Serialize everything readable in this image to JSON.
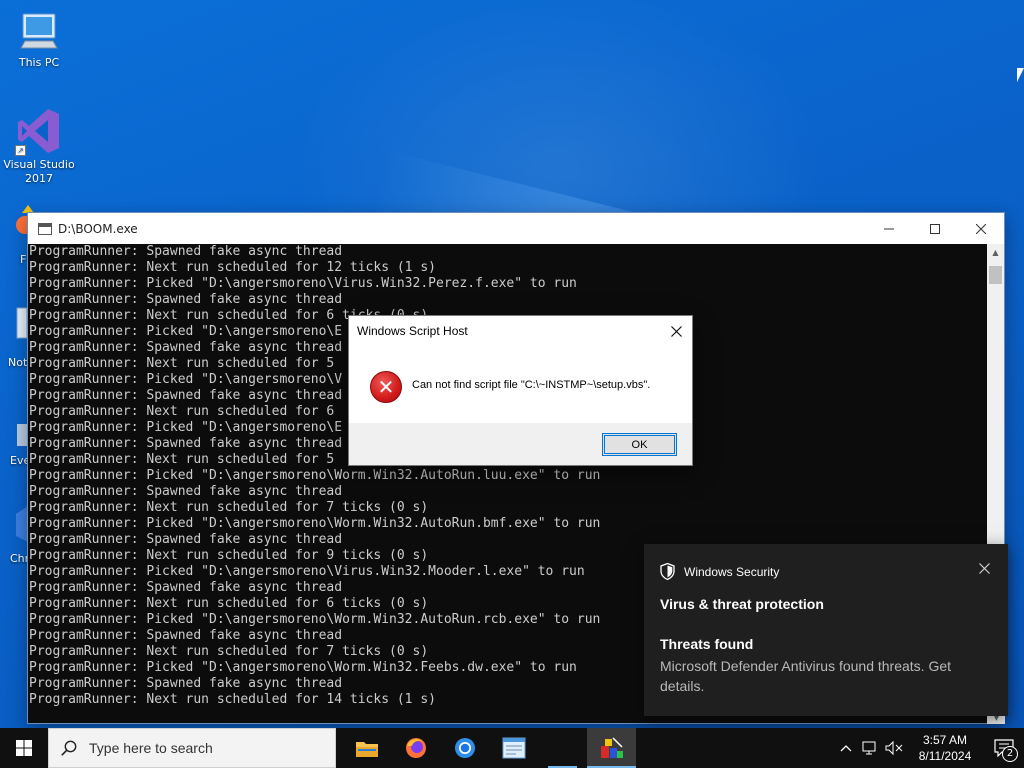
{
  "desktop": {
    "icons": [
      {
        "label": "This PC"
      },
      {
        "label": "Visual Studio 2017"
      }
    ],
    "partial_labels": [
      "F",
      "Not",
      "Eve",
      "Chr"
    ]
  },
  "console": {
    "title": "D:\\BOOM.exe",
    "lines": [
      "ProgramRunner: Spawned fake async thread",
      "ProgramRunner: Next run scheduled for 12 ticks (1 s)",
      "ProgramRunner: Picked \"D:\\angersmoreno\\Virus.Win32.Perez.f.exe\" to run",
      "ProgramRunner: Spawned fake async thread",
      "ProgramRunner: Next run scheduled for 6 ticks (0 s)",
      "ProgramRunner: Picked \"D:\\angersmoreno\\E",
      "ProgramRunner: Spawned fake async thread",
      "ProgramRunner: Next run scheduled for 5",
      "ProgramRunner: Picked \"D:\\angersmoreno\\V",
      "ProgramRunner: Spawned fake async thread",
      "ProgramRunner: Next run scheduled for 6",
      "ProgramRunner: Picked \"D:\\angersmoreno\\E",
      "ProgramRunner: Spawned fake async thread",
      "ProgramRunner: Next run scheduled for 5",
      "ProgramRunner: Picked \"D:\\angersmoreno\\Worm.Win32.AutoRun.luu.exe\" to run",
      "ProgramRunner: Spawned fake async thread",
      "ProgramRunner: Next run scheduled for 7 ticks (0 s)",
      "ProgramRunner: Picked \"D:\\angersmoreno\\Worm.Win32.AutoRun.bmf.exe\" to run",
      "ProgramRunner: Spawned fake async thread",
      "ProgramRunner: Next run scheduled for 9 ticks (0 s)",
      "ProgramRunner: Picked \"D:\\angersmoreno\\Virus.Win32.Mooder.l.exe\" to run",
      "ProgramRunner: Spawned fake async thread",
      "ProgramRunner: Next run scheduled for 6 ticks (0 s)",
      "ProgramRunner: Picked \"D:\\angersmoreno\\Worm.Win32.AutoRun.rcb.exe\" to run",
      "ProgramRunner: Spawned fake async thread",
      "ProgramRunner: Next run scheduled for 7 ticks (0 s)",
      "ProgramRunner: Picked \"D:\\angersmoreno\\Worm.Win32.Feebs.dw.exe\" to run",
      "ProgramRunner: Spawned fake async thread",
      "ProgramRunner: Next run scheduled for 14 ticks (1 s)"
    ]
  },
  "dialog": {
    "title": "Windows Script Host",
    "message": "Can not find script file \"C:\\~INSTMP~\\setup.vbs\".",
    "ok_label": "OK"
  },
  "toast": {
    "app_name": "Windows Security",
    "heading": "Virus & threat protection",
    "subheading": "Threats found",
    "body": "Microsoft Defender Antivirus found threats. Get details."
  },
  "taskbar": {
    "search_placeholder": "Type here to search",
    "apps": [
      "file-explorer-icon",
      "firefox-icon",
      "chrome-icon",
      "notepad-icon",
      "boom-app-icon"
    ],
    "clock_time": "3:57 AM",
    "clock_date": "8/11/2024",
    "notification_count": "2"
  },
  "colors": {
    "desktop_blue": "#0a62c9",
    "console_bg": "#0c0c0c",
    "console_text": "#cccccc",
    "toast_bg": "#1f1f1f",
    "accent": "#0078d7"
  }
}
